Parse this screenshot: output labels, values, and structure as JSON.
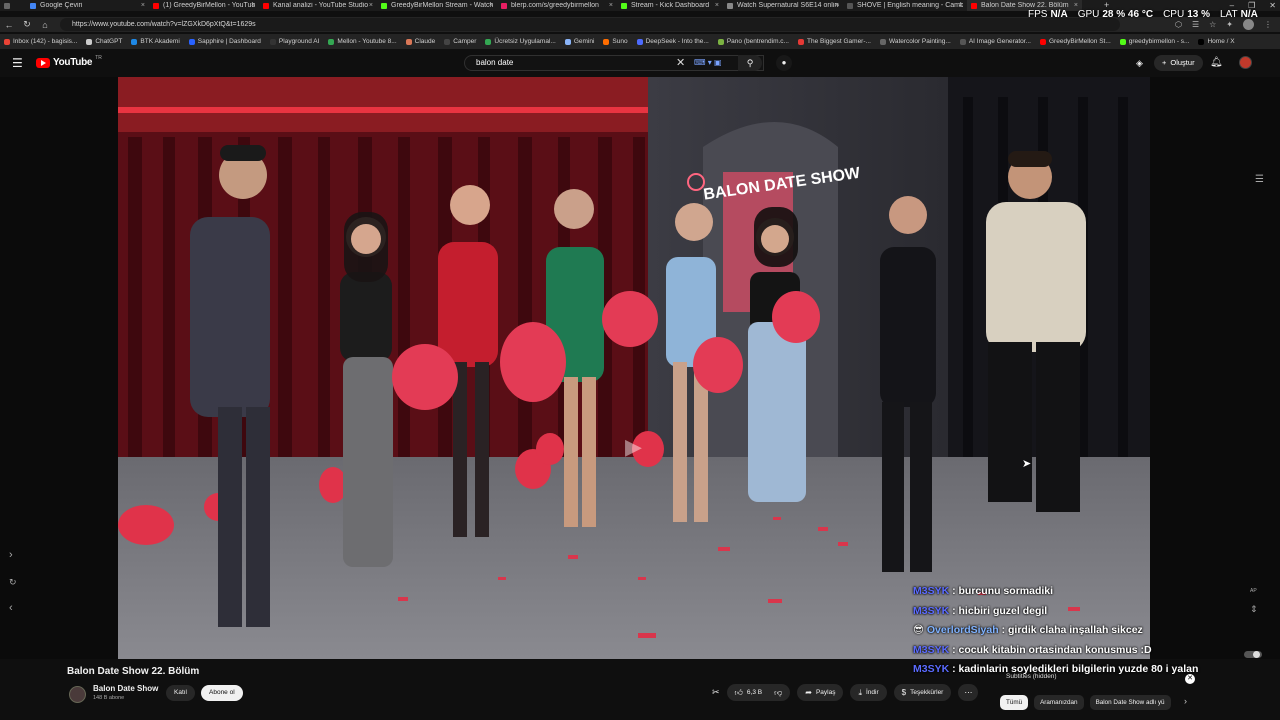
{
  "browser": {
    "tabs": [
      {
        "label": "Google Çeviri",
        "color": "#4285f4",
        "active": false
      },
      {
        "label": "(1) GreedyBirMellon - YouTube",
        "color": "#ff0000",
        "active": false
      },
      {
        "label": "Kanal analizi - YouTube Studio",
        "color": "#ff0000",
        "active": false
      },
      {
        "label": "GreedyBirMellon Stream - Watch",
        "color": "#53fc18",
        "active": false
      },
      {
        "label": "blerp.com/s/greedybirmellon",
        "color": "#e91e63",
        "active": false
      },
      {
        "label": "Stream - Kick Dashboard",
        "color": "#53fc18",
        "active": false
      },
      {
        "label": "Watch Supernatural S6E14 online",
        "color": "#888888",
        "active": false
      },
      {
        "label": "SHOVE | English meaning - Camb",
        "color": "#555555",
        "active": false
      },
      {
        "label": "Balon Date Show 22. Bölüm",
        "color": "#ff0000",
        "active": true
      }
    ],
    "new_tab": "+",
    "window_controls": [
      "–",
      "❐",
      "✕"
    ],
    "url": "https://www.youtube.com/watch?v=lZGXkD6pXtQ&t=1629s",
    "bookmarks": [
      {
        "label": "Inbox (142) - bagisis...",
        "color": "#ea4335"
      },
      {
        "label": "ChatGPT",
        "color": "#cccccc"
      },
      {
        "label": "BTK Akademi",
        "color": "#1e88e5"
      },
      {
        "label": "Sapphire | Dashboard",
        "color": "#2962ff"
      },
      {
        "label": "Playground AI",
        "color": "#333333"
      },
      {
        "label": "Mellon - Youtube 8...",
        "color": "#34a853"
      },
      {
        "label": "Claude",
        "color": "#d97757"
      },
      {
        "label": "Camper",
        "color": "#444444"
      },
      {
        "label": "Ücretsiz Uygulamal...",
        "color": "#34a853"
      },
      {
        "label": "Gemini",
        "color": "#8ab4f8"
      },
      {
        "label": "Suno",
        "color": "#ff6d00"
      },
      {
        "label": "DeepSeek - Into the...",
        "color": "#4d6bfe"
      },
      {
        "label": "Pano (bentrendim.c...",
        "color": "#7cb342"
      },
      {
        "label": "The Biggest Gamer-...",
        "color": "#e53935"
      },
      {
        "label": "Watercolor Painting...",
        "color": "#666666"
      },
      {
        "label": "AI Image Generator...",
        "color": "#555555"
      },
      {
        "label": "GreedyBirMellon St...",
        "color": "#ff0000"
      },
      {
        "label": "greedybirmellon - s...",
        "color": "#53fc18"
      },
      {
        "label": "Home / X",
        "color": "#000000"
      }
    ]
  },
  "overlay": {
    "fps_label": "FPS",
    "fps_value": "N/A",
    "gpu_label": "GPU",
    "gpu_value": "28 % 46 °C",
    "cpu_label": "CPU",
    "cpu_value": "13 %",
    "lat_label": "LAT",
    "lat_value": "N/A"
  },
  "youtube": {
    "logo_text": "YouTube",
    "region": "TR",
    "search_value": "balon date",
    "create_label": "Oluştur",
    "video": {
      "title": "Balon Date Show 22. Bölüm",
      "channel": "Balon Date Show",
      "subscribers": "148 B abone",
      "join_label": "Katıl",
      "subscribe_label": "Abone ol",
      "likes": "6,3 B",
      "share_label": "Paylaş",
      "download_label": "İndir",
      "thanks_label": "Teşekkürler",
      "sign_text": "BALON DATE SHOW"
    },
    "chat": [
      {
        "user": "M3SYK",
        "message": ": burcunu sormadiki",
        "color": "#5b6bff"
      },
      {
        "user": "M3SYK",
        "message": ": hicbiri guzel degil",
        "color": "#5b6bff"
      },
      {
        "user": "OverlordSiyah",
        "message": ": girdik claha inşallah sikcez",
        "color": "#7fb2ff"
      },
      {
        "user": "M3SYK",
        "message": ": cocuk kitabin ortasindan konusmus :D",
        "color": "#5b6bff"
      },
      {
        "user": "M3SYK",
        "message": ": kadinlarin soyledikleri bilgilerin yuzde 80 i yalan",
        "color": "#5b6bff"
      }
    ],
    "subtitles_status": "Subtitles (hidden)",
    "ap_label": "AP",
    "chips": [
      {
        "label": "Tümü",
        "active": true
      },
      {
        "label": "Aramanızdan",
        "active": false
      },
      {
        "label": "Balon Date Show adlı yü",
        "active": false
      }
    ]
  }
}
